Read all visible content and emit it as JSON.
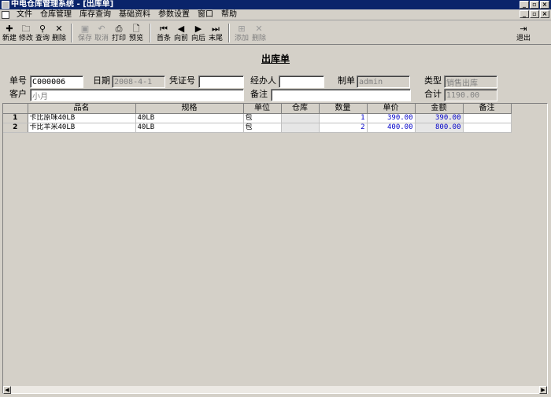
{
  "window": {
    "title": "中电仓库管理系统 - [出库单]"
  },
  "menu": [
    "文件",
    "仓库管理",
    "库存查询",
    "基础资料",
    "参数设置",
    "窗口",
    "帮助"
  ],
  "toolbar": {
    "new": "新建",
    "edit": "修改",
    "query": "查询",
    "delete": "删除",
    "save": "保存",
    "cancel": "取消",
    "print": "打印",
    "preview": "预览",
    "first": "首条",
    "prev": "向前",
    "next": "向后",
    "last": "末尾",
    "add": "添加",
    "remove": "删除",
    "exit": "退出"
  },
  "form": {
    "title": "出库单",
    "order_no_label": "单号",
    "order_no": "C000006",
    "date_label": "日期",
    "date": "2008-4-1",
    "voucher_label": "凭证号",
    "voucher": "",
    "handler_label": "经办人",
    "handler": "",
    "maker_label": "制单",
    "maker": "admin",
    "type_label": "类型",
    "type": "销售出库",
    "customer_label": "客户",
    "customer": "小月",
    "remark_label": "备注",
    "remark": "",
    "total_label": "合计",
    "total": "1190.00"
  },
  "grid": {
    "columns": [
      "品名",
      "规格",
      "单位",
      "仓库",
      "数量",
      "单价",
      "金额",
      "备注"
    ],
    "rows": [
      {
        "num": "1",
        "name": "卡比原味40LB",
        "spec": "40LB",
        "unit": "包",
        "warehouse": "",
        "qty": "1",
        "price": "390.00",
        "amount": "390.00",
        "note": ""
      },
      {
        "num": "2",
        "name": "卡比羊米40LB",
        "spec": "40LB",
        "unit": "包",
        "warehouse": "",
        "qty": "2",
        "price": "400.00",
        "amount": "800.00",
        "note": ""
      }
    ]
  }
}
